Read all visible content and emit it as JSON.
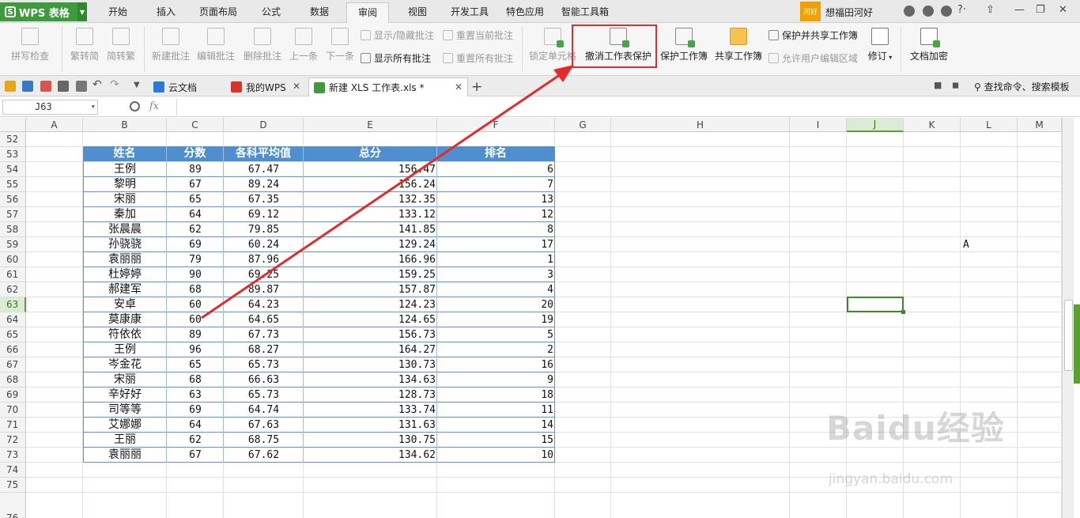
{
  "app": {
    "name": "WPS 表格",
    "logo": "S"
  },
  "menu_tabs": [
    "开始",
    "插入",
    "页面布局",
    "公式",
    "数据",
    "审阅",
    "视图",
    "开发工具",
    "特色应用",
    "智能工具箱"
  ],
  "active_tab": "审阅",
  "user": {
    "badge": "河好",
    "name": "想福田河好"
  },
  "ribbon": {
    "spellcheck": "拼写检查",
    "trad_to_simp": "繁转简",
    "simp_to_trad": "简转繁",
    "new_comment": "新建批注",
    "edit_comment": "编辑批注",
    "delete_comment": "删除批注",
    "prev": "上一条",
    "next": "下一条",
    "show_hide_comment": "显示/隐藏批注",
    "reset_current_comment": "重置当前批注",
    "show_all_comments": "显示所有批注",
    "reset_all_comments": "重置所有批注",
    "lock_cell": "锁定单元格",
    "unprotect_sheet": "撤消工作表保护",
    "protect_workbook": "保护工作簿",
    "share_workbook": "共享工作簿",
    "protect_share_workbook": "保护并共享工作簿",
    "allow_edit_ranges": "允许用户编辑区域",
    "revise": "修订",
    "doc_encrypt": "文档加密"
  },
  "doc_tabs": [
    {
      "label": "云文档"
    },
    {
      "label": "我的WPS"
    },
    {
      "label": "新建 XLS 工作表.xls *"
    }
  ],
  "search_command": "查找命令、搜索模板",
  "name_box": "J63",
  "fx_label": "fx",
  "columns": [
    "A",
    "B",
    "C",
    "D",
    "E",
    "F",
    "G",
    "H",
    "I",
    "J",
    "K",
    "L",
    "M"
  ],
  "rows": [
    "52",
    "53",
    "54",
    "55",
    "56",
    "57",
    "58",
    "59",
    "60",
    "61",
    "62",
    "63",
    "64",
    "65",
    "66",
    "67",
    "68",
    "69",
    "70",
    "71",
    "72",
    "73",
    "74",
    "75",
    "76"
  ],
  "table": {
    "headers": [
      "姓名",
      "分数",
      "各科平均值",
      "总分",
      "排名"
    ],
    "rows": [
      [
        "王例",
        "89",
        "67.47",
        "156.47",
        "6"
      ],
      [
        "黎明",
        "67",
        "89.24",
        "156.24",
        "7"
      ],
      [
        "宋丽",
        "65",
        "67.35",
        "132.35",
        "13"
      ],
      [
        "秦加",
        "64",
        "69.12",
        "133.12",
        "12"
      ],
      [
        "张晨晨",
        "62",
        "79.85",
        "141.85",
        "8"
      ],
      [
        "孙骁骁",
        "69",
        "60.24",
        "129.24",
        "17"
      ],
      [
        "袁丽丽",
        "79",
        "87.96",
        "166.96",
        "1"
      ],
      [
        "杜婷婷",
        "90",
        "69.25",
        "159.25",
        "3"
      ],
      [
        "郝建军",
        "68",
        "89.87",
        "157.87",
        "4"
      ],
      [
        "安卓",
        "60",
        "64.23",
        "124.23",
        "20"
      ],
      [
        "莫康康",
        "60",
        "64.65",
        "124.65",
        "19"
      ],
      [
        "符依依",
        "89",
        "67.73",
        "156.73",
        "5"
      ],
      [
        "王例",
        "96",
        "68.27",
        "164.27",
        "2"
      ],
      [
        "岑金花",
        "65",
        "65.73",
        "130.73",
        "16"
      ],
      [
        "宋丽",
        "68",
        "66.63",
        "134.63",
        "9"
      ],
      [
        "辛好好",
        "63",
        "65.73",
        "128.73",
        "18"
      ],
      [
        "司等等",
        "69",
        "64.74",
        "133.74",
        "11"
      ],
      [
        "艾娜娜",
        "64",
        "67.63",
        "131.63",
        "14"
      ],
      [
        "王丽",
        "62",
        "68.75",
        "130.75",
        "15"
      ],
      [
        "袁丽丽",
        "67",
        "67.62",
        "134.62",
        "10"
      ]
    ]
  },
  "l59_value": "A",
  "watermark": {
    "main": "Baidu经验",
    "sub": "jingyan.baidu.com"
  },
  "colors": {
    "brand_green": "#3d9a3d",
    "table_header": "#4f8fcf",
    "highlight_red": "#e32b2b",
    "selection_green": "#3a8b2c"
  }
}
